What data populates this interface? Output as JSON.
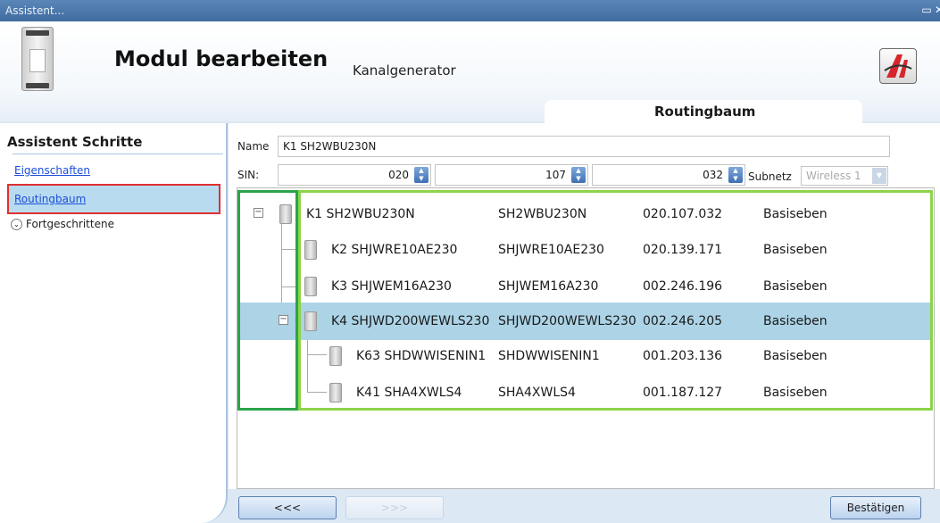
{
  "window": {
    "title": "Assistent...",
    "restore_icon": "maximize-icon",
    "close_icon": "close-icon"
  },
  "header": {
    "title": "Modul bearbeiten",
    "subtitle": "Kanalgenerator",
    "tab": "Routingbaum",
    "device_icon": "din-rail-module-icon",
    "logo_icon": "brand-logo-icon"
  },
  "sidebar": {
    "title": "Assistent Schritte",
    "items": [
      {
        "label": "Eigenschaften",
        "selected": false
      },
      {
        "label": "Routingbaum",
        "selected": true
      }
    ],
    "advanced_label": "Fortgeschrittene"
  },
  "form": {
    "name_label": "Name",
    "name_value": "K1 SH2WBU230N",
    "sin_label": "SIN:",
    "sin_values": [
      "020",
      "107",
      "032"
    ],
    "subnet_label": "Subnetz",
    "subnet_value": "Wireless 1"
  },
  "tree": {
    "rows": [
      {
        "name": "K1 SH2WBU230N",
        "type": "SH2WBU230N",
        "address": "020.107.032",
        "level": "Basiseben",
        "depth": 0,
        "expander": "−",
        "selected": false
      },
      {
        "name": "K2 SHJWRE10AE230",
        "type": "SHJWRE10AE230",
        "address": "020.139.171",
        "level": "Basiseben",
        "depth": 1,
        "expander": "",
        "selected": false
      },
      {
        "name": "K3 SHJWEM16A230",
        "type": "SHJWEM16A230",
        "address": "002.246.196",
        "level": "Basiseben",
        "depth": 1,
        "expander": "",
        "selected": false
      },
      {
        "name": "K4 SHJWD200WEWLS230",
        "type": "SHJWD200WEWLS230",
        "address": "002.246.205",
        "level": "Basiseben",
        "depth": 1,
        "expander": "−",
        "selected": true
      },
      {
        "name": "K63 SHDWWISENIN1",
        "type": "SHDWWISENIN1",
        "address": "001.203.136",
        "level": "Basiseben",
        "depth": 2,
        "expander": "",
        "selected": false
      },
      {
        "name": "K41 SHA4XWLS4",
        "type": "SHA4XWLS4",
        "address": "001.187.127",
        "level": "Basiseben",
        "depth": 2,
        "expander": "",
        "selected": false
      }
    ]
  },
  "footer": {
    "back_label": "<<<",
    "next_label": ">>>",
    "confirm_label": "Bestätigen"
  }
}
